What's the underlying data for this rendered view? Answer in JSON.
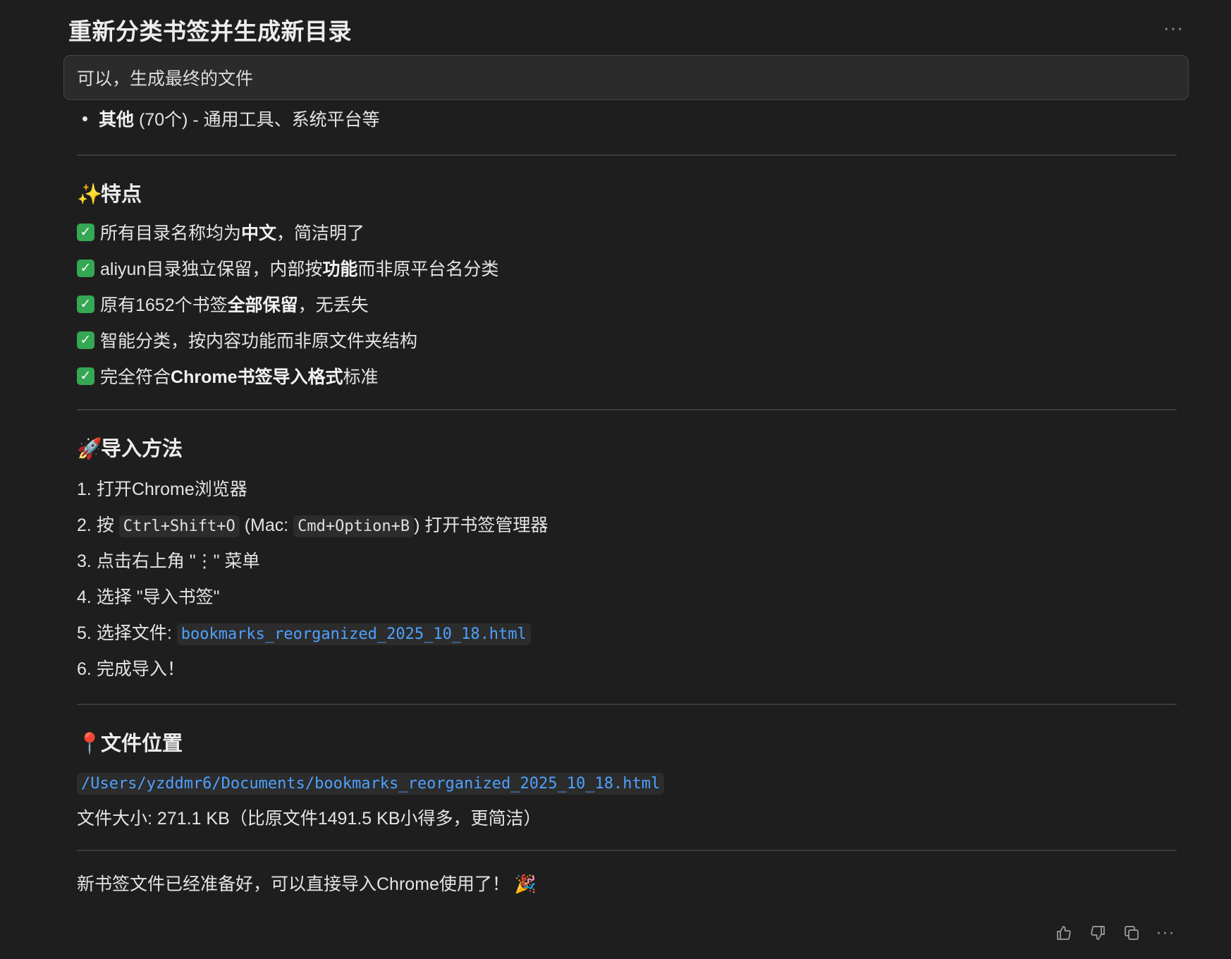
{
  "header": {
    "title": "重新分类书签并生成新目录",
    "more_label": "···"
  },
  "prompt": {
    "text": "可以，生成最终的文件"
  },
  "category_bullet": {
    "bold": "其他",
    "rest": " (70个) - 通用工具、系统平台等"
  },
  "features": {
    "emoji": "✨",
    "heading": "特点",
    "check_symbol": "✓",
    "items": [
      {
        "pre": "所有目录名称均为",
        "bold": "中文",
        "post": "，简洁明了"
      },
      {
        "pre": "aliyun目录独立保留，内部按",
        "bold": "功能",
        "post": "而非原平台名分类"
      },
      {
        "pre": "原有1652个书签",
        "bold": "全部保留",
        "post": "，无丢失"
      },
      {
        "pre": "智能分类，按内容功能而非原文件夹结构",
        "bold": "",
        "post": ""
      },
      {
        "pre": "完全符合",
        "bold": "Chrome书签导入格式",
        "post": "标准"
      }
    ]
  },
  "import": {
    "emoji": "🚀",
    "heading": "导入方法",
    "steps": {
      "s1": {
        "num": "1.",
        "text": "打开Chrome浏览器"
      },
      "s2": {
        "num": "2.",
        "pre": "按",
        "code1": "Ctrl+Shift+O",
        "mid": "(Mac:",
        "code2": "Cmd+Option+B",
        "post": ") 打开书签管理器"
      },
      "s3": {
        "num": "3.",
        "text": "点击右上角 \"⋮\" 菜单"
      },
      "s4": {
        "num": "4.",
        "text": "选择 \"导入书签\""
      },
      "s5": {
        "num": "5.",
        "pre": "选择文件:",
        "code": "bookmarks_reorganized_2025_10_18.html"
      },
      "s6": {
        "num": "6.",
        "text": "完成导入！"
      }
    }
  },
  "location": {
    "emoji": "📍",
    "heading": "文件位置",
    "path": "/Users/yzddmr6/Documents/bookmarks_reorganized_2025_10_18.html",
    "size_text": "文件大小: 271.1 KB（比原文件1491.5 KB小得多，更简洁）"
  },
  "closing": {
    "text": "新书签文件已经准备好，可以直接导入Chrome使用了！",
    "emoji": "🎉"
  },
  "footer": {
    "icons": [
      "thumbs-up-icon",
      "thumbs-down-icon",
      "copy-icon",
      "more-icon"
    ],
    "more_label": "···"
  },
  "colors": {
    "background": "#1e1e1e",
    "prompt_background": "#2b2b2b",
    "link": "#4ea1ff",
    "check": "#34a853"
  }
}
